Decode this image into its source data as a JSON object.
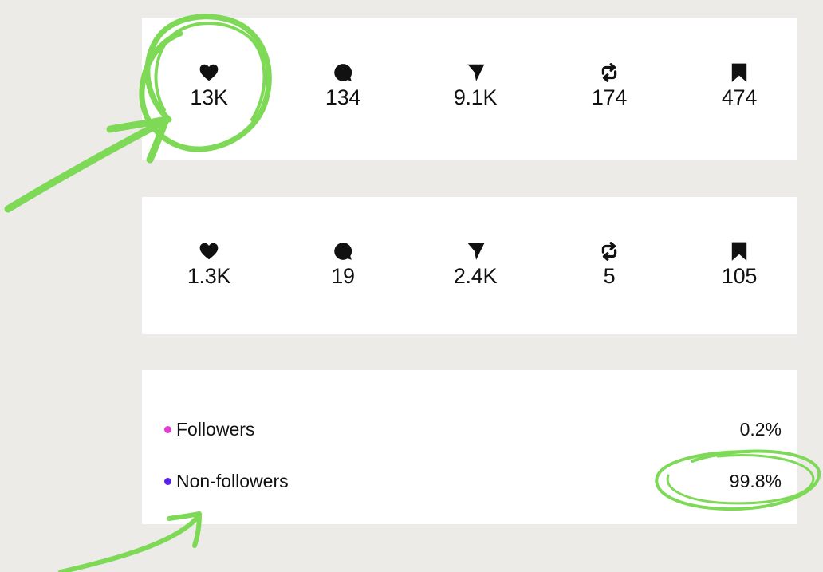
{
  "posts": [
    {
      "stats": [
        {
          "icon": "heart-icon",
          "value": "13K"
        },
        {
          "icon": "comment-icon",
          "value": "134"
        },
        {
          "icon": "share-icon",
          "value": "9.1K"
        },
        {
          "icon": "repost-icon",
          "value": "174"
        },
        {
          "icon": "bookmark-icon",
          "value": "474"
        }
      ]
    },
    {
      "stats": [
        {
          "icon": "heart-icon",
          "value": "1.3K"
        },
        {
          "icon": "comment-icon",
          "value": "19"
        },
        {
          "icon": "share-icon",
          "value": "2.4K"
        },
        {
          "icon": "repost-icon",
          "value": "5"
        },
        {
          "icon": "bookmark-icon",
          "value": "105"
        }
      ]
    }
  ],
  "audience": {
    "followers": {
      "label": "Followers",
      "value": "0.2%",
      "color": "#e03bd4"
    },
    "non_followers": {
      "label": "Non-followers",
      "value": "99.8%",
      "color": "#5b22e6"
    }
  },
  "annotation_color": "#7ed957"
}
